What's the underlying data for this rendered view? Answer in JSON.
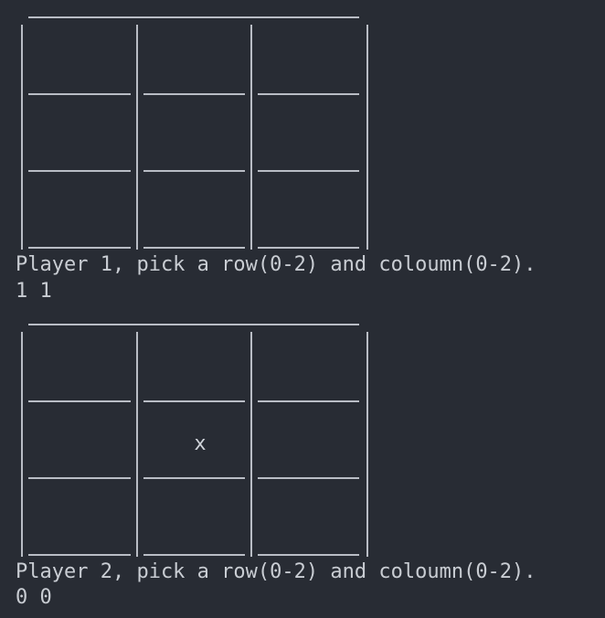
{
  "terminal": {
    "background": "#282c34",
    "foreground": "#c9cdd3",
    "boards": [
      {
        "cells": [
          [
            "",
            "",
            ""
          ],
          [
            "",
            "",
            ""
          ],
          [
            "",
            "",
            ""
          ]
        ],
        "prompt": "Player 1, pick a row(0-2) and coloumn(0-2).",
        "input": "1 1"
      },
      {
        "cells": [
          [
            "",
            "",
            ""
          ],
          [
            "",
            "x",
            ""
          ],
          [
            "",
            "",
            ""
          ]
        ],
        "prompt": "Player 2, pick a row(0-2) and coloumn(0-2).",
        "input": "0 0"
      }
    ]
  }
}
